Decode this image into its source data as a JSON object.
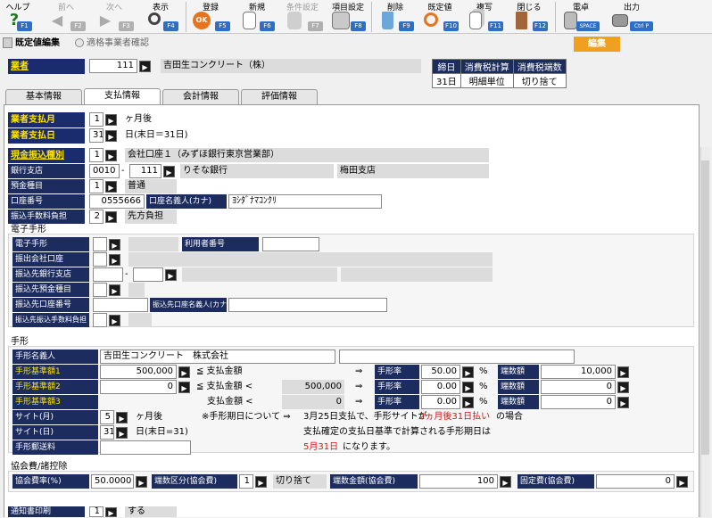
{
  "toolbar": {
    "help": "ヘルプ",
    "help_key": "F1",
    "prev": "前へ",
    "prev_key": "F2",
    "next": "次へ",
    "next_key": "F3",
    "view": "表示",
    "view_key": "F4",
    "register": "登録",
    "register_key": "F5",
    "new": "新規",
    "new_key": "F6",
    "condition": "条件設定",
    "condition_key": "F7",
    "item_setting": "項目設定",
    "item_setting_key": "F8",
    "delete": "削除",
    "delete_key": "F9",
    "default": "既定値",
    "default_key": "F10",
    "copy": "複写",
    "copy_key": "F11",
    "close": "閉じる",
    "close_key": "F12",
    "calc": "電卓",
    "calc_key": "SPACE",
    "output": "出力",
    "output_key": "Ctrl P"
  },
  "mode": {
    "default_edit": "既定値編集",
    "eligible_check": "適格事業者確認",
    "edit_badge": "編集"
  },
  "vendor": {
    "label": "業者",
    "code": "111",
    "name": "吉田生コンクリート（株）"
  },
  "summary": {
    "headers": [
      "締日",
      "消費税計算",
      "消費税端数"
    ],
    "values": [
      "31日",
      "明細単位",
      "切り捨て"
    ]
  },
  "tabs": [
    "基本情報",
    "支払情報",
    "会計情報",
    "評価情報"
  ],
  "pay": {
    "month_label": "業者支払月",
    "month_value": "1",
    "month_unit": "ヶ月後",
    "day_label": "業者支払日",
    "day_value": "31",
    "day_note": "日(末日＝31日)"
  },
  "bank": {
    "transfer_type_label": "現金振込種別",
    "transfer_type_value": "1",
    "transfer_type_text": "会社口座１（みずほ銀行東京営業部）",
    "branch_label": "銀行支店",
    "bank_code": "0010",
    "branch_code": "111",
    "bank_name": "りそな銀行",
    "branch_name": "梅田支店",
    "deposit_type_label": "預金種目",
    "deposit_type_value": "1",
    "deposit_type_text": "普通",
    "account_no_label": "口座番号",
    "account_no": "0555666",
    "account_name_label": "口座名義人(カナ)",
    "account_name": "ﾖｼﾀﾞﾅﾏｺﾝｸﾘ",
    "fee_label": "振込手数料負担",
    "fee_value": "2",
    "fee_text": "先方負担"
  },
  "edenshi": {
    "section": "電子手形",
    "e_note": "電子手形",
    "user_no": "利用者番号",
    "from_company": "振出会社口座",
    "to_bank": "振込先銀行支店",
    "to_deposit": "振込先預金種目",
    "to_account": "振込先口座番号",
    "to_account_name": "振込先口座名義人(カナ)",
    "to_fee": "振込先振込手数料負担"
  },
  "tegata": {
    "section": "手形",
    "name_label": "手形名義人",
    "name_value": "吉田生コンクリート　株式会社",
    "std1": "手形基準額1",
    "std1_value": "500,000",
    "cond1": "≦ 支払金額",
    "rate_label": "手形率",
    "rate1": "50.00",
    "pct": "%",
    "frac_label": "端数額",
    "frac1": "10,000",
    "std2": "手形基準額2",
    "std2_value": "0",
    "cond2": "≦ 支払金額 <",
    "mid_value": "500,000",
    "rate2": "0.00",
    "frac2": "0",
    "std3": "手形基準額3",
    "cond3": "支払金額 <",
    "low_value": "0",
    "rate3": "0.00",
    "frac3": "0",
    "arrow": "⇒",
    "site_m_label": "サイト(月)",
    "site_m_value": "5",
    "site_m_unit": "ヶ月後",
    "site_d_label": "サイト(日)",
    "site_d_value": "31",
    "site_d_note": "日(末日=31)",
    "postage_label": "手形郵送料",
    "note_head": "※手形期日について ⇒",
    "note1a": "3月25日支払で、手形サイトが",
    "note1b": "2ヵ月後31日払い",
    "note1c": "の場合",
    "note2": "支払確定の支払日基準で計算される手形期日は",
    "note3a": "5月31日",
    "note3b": "になります。"
  },
  "kyokai": {
    "section": "協会費/諸控除",
    "rate_label": "協会費率(%)",
    "rate_value": "50.0000",
    "frac_type_label": "端数区分(協会費)",
    "frac_type_value": "1",
    "frac_type_text": "切り捨て",
    "frac_amt_label": "端数金額(協会費)",
    "frac_amt_value": "100",
    "fixed_label": "固定費(協会費)",
    "fixed_value": "0"
  },
  "bottom": {
    "label": "通知書印刷",
    "value": "1",
    "text": "する"
  },
  "colors": {
    "label_bg": "#1a2b6e",
    "label_fg": "#ffe400",
    "nav_bg": "#1d2c5e",
    "accent": "#f0a020"
  }
}
